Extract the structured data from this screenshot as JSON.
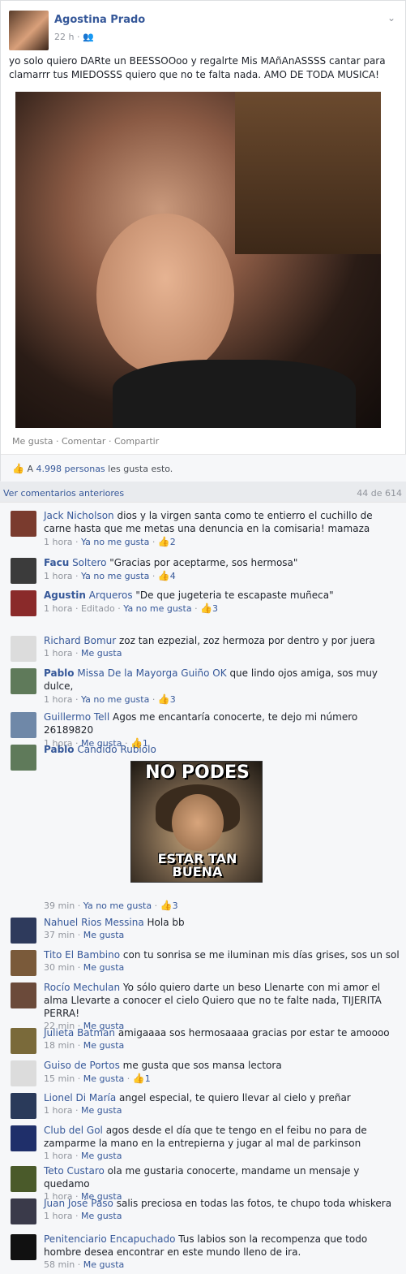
{
  "post": {
    "author": "Agostina Prado",
    "time": "22 h",
    "audience_icon": "friends-icon",
    "text": "yo solo quiero DARte un BEESSOOoo y regalrte Mis MAñAnASSSS cantar para clamarrr tus MIEDOSSS quiero que no te falta nada. AMO DE TODA MUSICA!",
    "actions": {
      "like": "Me gusta",
      "comment": "Comentar",
      "share": "Compartir"
    },
    "likes": {
      "prefix": "A",
      "count": "4.998",
      "people": "personas",
      "suffix": "les gusta esto."
    }
  },
  "comments_header": {
    "previous": "Ver comentarios anteriores",
    "count": "44 de 614"
  },
  "comments": [
    {
      "name": "Jack Nicholson",
      "text": "dios y la virgen santa como te entierro el cuchillo de carne hasta que me metas una denuncia en la comisaria! mamaza",
      "time": "1 hora",
      "action": "Ya no me gusta",
      "likes": "2",
      "avatar_color": "#7a3b2e"
    },
    {
      "name": "Facu",
      "name2": "Soltero",
      "text": "\"Gracias por aceptarme, sos hermosa\"",
      "time": "1 hora",
      "action": "Ya no me gusta",
      "likes": "4",
      "avatar_color": "#3b3b3b"
    },
    {
      "name": "Agustin",
      "name2": "Arqueros",
      "text": "\"De que jugeteria te escapaste muñeca\"",
      "time": "1 hora",
      "edited": "Editado",
      "action": "Ya no me gusta",
      "likes": "3",
      "avatar_color": "#8a2a2a"
    },
    {
      "name": "Richard Bomur",
      "text": "zoz tan ezpezial, zoz hermoza por dentro y por juera",
      "time": "1 hora",
      "action": "Me gusta",
      "avatar_color": "#dcdcdc"
    },
    {
      "name": "Pablo",
      "name2": "Missa De la Mayorga Guiño OK",
      "text": "que lindo ojos amiga, sos muy dulce,",
      "time": "1 hora",
      "action": "Ya no me gusta",
      "likes": "3",
      "avatar_color": "#5f7a5a"
    },
    {
      "name": "Guillermo Tell",
      "text": "Agos me encantaría conocerte, te dejo mi número 26189820",
      "time": "1 hora",
      "action": "Me gusta",
      "likes": "1",
      "avatar_color": "#6f88a8"
    },
    {
      "name": "Pablo",
      "name2": "Candido Rubiolo",
      "text": "",
      "time": "39 min",
      "action": "Ya no me gusta",
      "likes": "3",
      "avatar_color": "#5f7a5a",
      "meme": {
        "top": "NO PODES",
        "bottom": "ESTAR TAN BUENA"
      }
    },
    {
      "name": "Nahuel Rios Messina",
      "text": "Hola bb",
      "time": "37 min",
      "action": "Me gusta",
      "avatar_color": "#2e3a5c"
    },
    {
      "name": "Tito El Bambino",
      "text": "con tu sonrisa se me iluminan mis días grises, sos un sol",
      "time": "30 min",
      "action": "Me gusta",
      "avatar_color": "#7a5a3a"
    },
    {
      "name": "Rocío Mechulan",
      "text": "Yo sólo quiero darte un beso Llenarte con mi amor el alma Llevarte a conocer el cielo Quiero que no te falte nada, TIJERITA PERRA!",
      "time": "22 min",
      "action": "Me gusta",
      "avatar_color": "#6b4a3a"
    },
    {
      "name": "Julieta Batman",
      "text": "amigaaaa sos hermosaaaa gracias por estar te amoooo",
      "time": "18 min",
      "action": "Me gusta",
      "avatar_color": "#7a6a3a"
    },
    {
      "name": "Guiso de Portos",
      "text": "me gusta que sos mansa lectora",
      "time": "15 min",
      "action": "Me gusta",
      "likes": "1",
      "avatar_color": "#dcdcdc"
    },
    {
      "name": "Lionel Di María",
      "text": "angel especial, te quiero llevar al cielo y preñar",
      "time": "1 hora",
      "action": "Me gusta",
      "avatar_color": "#2a3a5a"
    },
    {
      "name": "Club del Gol",
      "text": "agos desde el día que te tengo en el feibu no para de zamparme la mano en la entrepierna y jugar al mal de parkinson",
      "time": "1 hora",
      "action": "Me gusta",
      "avatar_color": "#1f2f6a"
    },
    {
      "name": "Teto Custaro",
      "text": "ola me gustaria conocerte, mandame un mensaje y quedamo",
      "time": "1 hora",
      "action": "Me gusta",
      "avatar_color": "#4a5a2a"
    },
    {
      "name": "Juan José Paso",
      "text": "salis preciosa en todas las fotos, te chupo toda whiskera",
      "time": "1 hora",
      "action": "Me gusta",
      "avatar_color": "#3a3a4a"
    },
    {
      "name": "Penitenciario Encapuchado",
      "text": "Tus labios son la recompenza que todo hombre desea encontrar en este mundo lleno de ira.",
      "time": "58 min",
      "action": "Me gusta",
      "avatar_color": "#111111"
    }
  ]
}
